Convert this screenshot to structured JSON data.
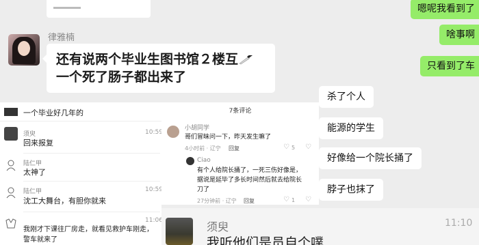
{
  "panel_a": {
    "sender_name": "律雅楠",
    "message_part1": "还有说两个毕业生图书馆２楼互",
    "message_part2": "一个死了肠子都出来了",
    "knife_icon": "knife-icon"
  },
  "panel_b": {
    "sent": [
      "嗯呢我看到了",
      "啥事啊",
      "只看到了车"
    ],
    "received": [
      "杀了个人",
      "能源的学生",
      "好像给一个院长捅了",
      "脖子也抹了"
    ]
  },
  "panel_c": {
    "header": "一个毕业好几年的",
    "comments": [
      {
        "name": "须臾",
        "time": "10:59",
        "text": "回来报复"
      },
      {
        "name": "陆仁甲",
        "time": "10:59",
        "text": "太神了"
      },
      {
        "name": "陆仁甲",
        "time": "10:59",
        "text": "沈工大舞台，有胆你就来"
      },
      {
        "name": "",
        "time": "11:06",
        "text": "我刚才下课往厂房走，就看见救护车刚走，",
        "text2": "警车就来了"
      }
    ]
  },
  "panel_d": {
    "title": "7条评论",
    "c1": {
      "name": "小胡同学",
      "text": "哥们冒昧问一下，昨天发生嘛了",
      "meta": "4小时前 · 辽宁",
      "reply": "回复",
      "likes": "5"
    },
    "c2": {
      "name": "Ciao",
      "line1": "有个人给院长捅了，一死三伤好像是，",
      "line2": "据说是延毕了多长时间然后就去给院长",
      "line3": "刀了",
      "meta": "27分钟前 · 辽宁",
      "reply": "回复",
      "likes": "1"
    }
  },
  "panel_e": {
    "name": "须臾",
    "time": "11:10",
    "text": "我听他们是员自个噗"
  }
}
